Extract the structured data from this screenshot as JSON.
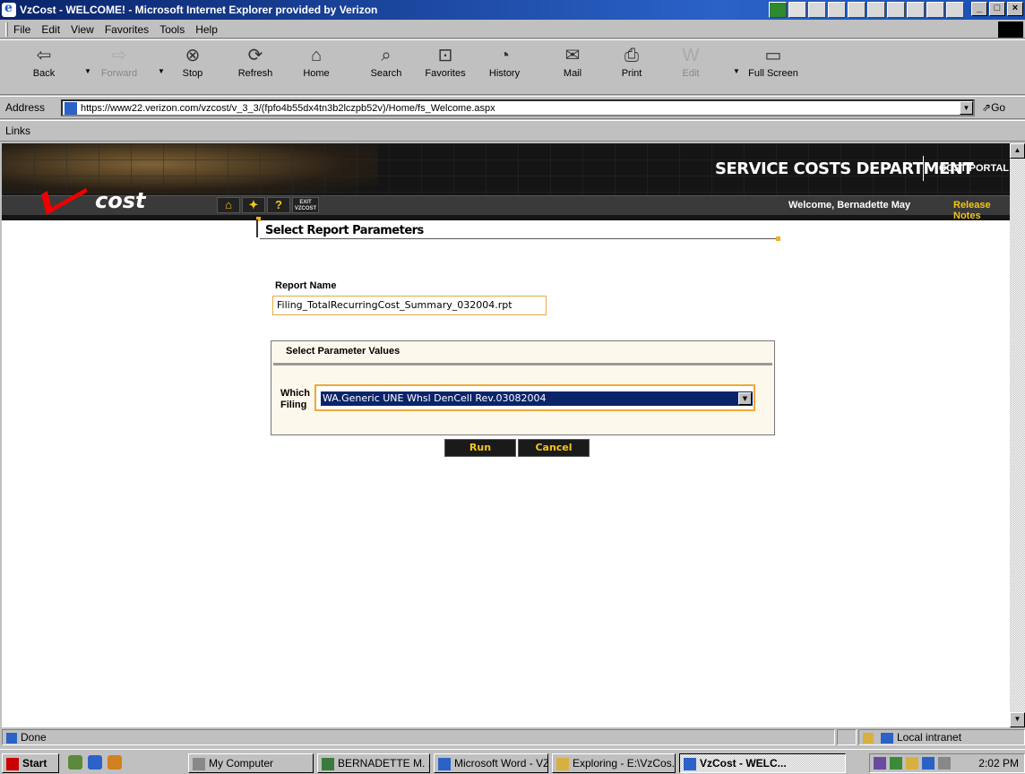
{
  "window": {
    "title": "VzCost - WELCOME! - Microsoft Internet Explorer provided by Verizon"
  },
  "menu": [
    "File",
    "Edit",
    "View",
    "Favorites",
    "Tools",
    "Help"
  ],
  "toolbar": {
    "back": "Back",
    "forward": "Forward",
    "stop": "Stop",
    "refresh": "Refresh",
    "home": "Home",
    "search": "Search",
    "favorites": "Favorites",
    "history": "History",
    "mail": "Mail",
    "print": "Print",
    "edit": "Edit",
    "fullscreen": "Full Screen"
  },
  "address": {
    "label": "Address",
    "url": "https://www22.verizon.com/vzcost/v_3_3/(fpfo4b55dx4tn3b2lczpb52v)/Home/fs_Welcome.aspx",
    "go": "Go"
  },
  "links": {
    "label": "Links"
  },
  "site": {
    "dept": "SERVICE COSTS DEPARTMENT",
    "portal": "COST PORTAL",
    "logo": "cost",
    "welcome": "Welcome, Bernadette May",
    "release_notes": "Release Notes",
    "nav_exit": "EXIT VZCOST"
  },
  "page": {
    "title": "Select Report Parameters",
    "report_name_label": "Report Name",
    "report_name": "Filing_TotalRecurringCost_Summary_032004.rpt",
    "param_header": "Select Parameter Values",
    "which_label_1": "Which",
    "which_label_2": "Filing",
    "filing_value": "WA.Generic UNE Whsl DenCell Rev.03082004",
    "run": "Run",
    "cancel": "Cancel"
  },
  "status": {
    "text": "Done",
    "zone": "Local intranet"
  },
  "taskbar": {
    "start": "Start",
    "tasks": [
      "My Computer",
      "BERNADETTE M. ...",
      "Microsoft Word - VZ...",
      "Exploring - E:\\VzCos...",
      "VzCost - WELC..."
    ],
    "clock": "2:02 PM"
  },
  "colors": {
    "titlebar": "#0a246a",
    "accent_yellow": "#f5c518",
    "logo_red": "#e00000",
    "selection": "#0a246a"
  }
}
